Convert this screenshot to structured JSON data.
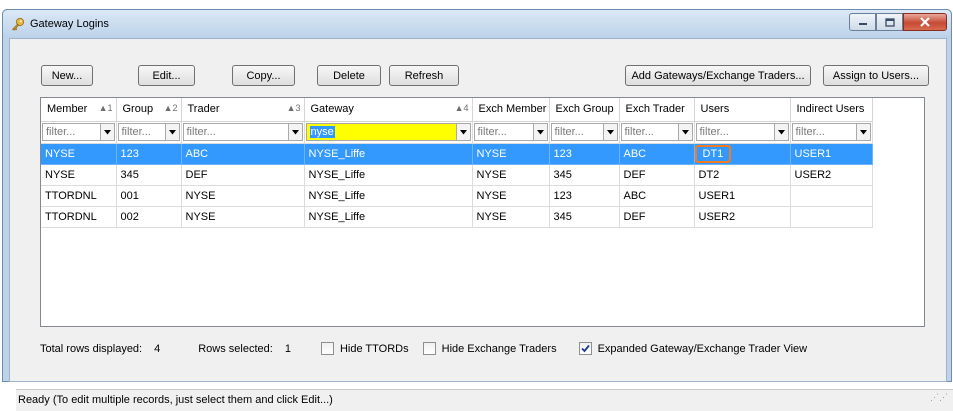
{
  "window": {
    "title": "Gateway Logins"
  },
  "toolbar": {
    "new": "New...",
    "edit": "Edit...",
    "copy": "Copy...",
    "delete": "Delete",
    "refresh": "Refresh",
    "add_gateways": "Add Gateways/Exchange Traders...",
    "assign_users": "Assign to Users..."
  },
  "grid": {
    "columns": [
      {
        "label": "Member",
        "sort": "▲1"
      },
      {
        "label": "Group",
        "sort": "▲2"
      },
      {
        "label": "Trader",
        "sort": "▲3"
      },
      {
        "label": "Gateway",
        "sort": "▲4"
      },
      {
        "label": "Exch Member",
        "sort": ""
      },
      {
        "label": "Exch Group",
        "sort": ""
      },
      {
        "label": "Exch Trader",
        "sort": ""
      },
      {
        "label": "Users",
        "sort": ""
      },
      {
        "label": "Indirect Users",
        "sort": ""
      }
    ],
    "filters": [
      "filter...",
      "filter...",
      "filter...",
      "nyse",
      "filter...",
      "filter...",
      "filter...",
      "filter...",
      "filter..."
    ],
    "rows": [
      [
        "NYSE",
        "123",
        "ABC",
        "NYSE_Liffe",
        "NYSE",
        "123",
        "ABC",
        "DT1",
        "USER1"
      ],
      [
        "NYSE",
        "345",
        "DEF",
        "NYSE_Liffe",
        "NYSE",
        "345",
        "DEF",
        "DT2",
        "USER2"
      ],
      [
        "TTORDNL",
        "001",
        "NYSE",
        "NYSE_Liffe",
        "NYSE",
        "123",
        "ABC",
        "USER1",
        ""
      ],
      [
        "TTORDNL",
        "002",
        "NYSE",
        "NYSE_Liffe",
        "NYSE",
        "345",
        "DEF",
        "USER2",
        ""
      ]
    ],
    "selected_row": 0
  },
  "footer": {
    "total_label": "Total rows displayed:",
    "total_value": "4",
    "selected_label": "Rows selected:",
    "selected_value": "1",
    "hide_ttords": "Hide TTORDs",
    "hide_exch": "Hide Exchange Traders",
    "expanded": "Expanded Gateway/Exchange Trader View",
    "hide_ttords_checked": false,
    "hide_exch_checked": false,
    "expanded_checked": true
  },
  "status": {
    "text": "Ready (To edit multiple records, just select them and click Edit...)"
  },
  "colors": {
    "selection": "#3399ff",
    "filter_active": "#ffff00",
    "highlight_box": "#f07a26"
  }
}
